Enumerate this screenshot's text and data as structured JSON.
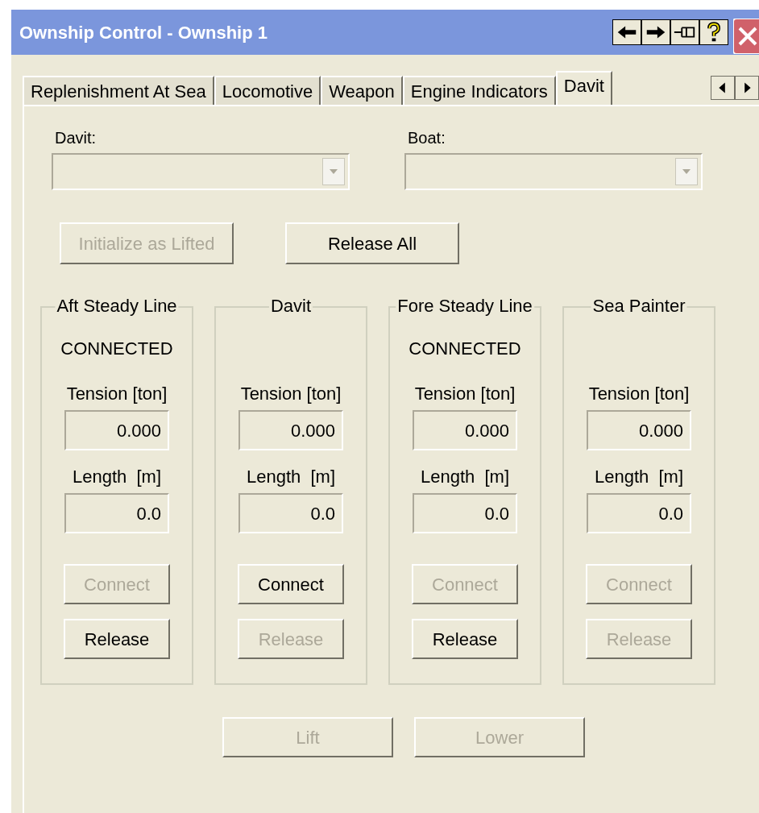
{
  "window": {
    "title": "Ownship Control - Ownship 1"
  },
  "tabs": [
    {
      "label": "Replenishment At Sea",
      "selected": false
    },
    {
      "label": "Locomotive",
      "selected": false
    },
    {
      "label": "Weapon",
      "selected": false
    },
    {
      "label": "Engine Indicators",
      "selected": false
    },
    {
      "label": "Davit",
      "selected": true
    }
  ],
  "selectors": [
    {
      "label": "Davit:",
      "disabled": true
    },
    {
      "label": "Boat:",
      "disabled": true
    }
  ],
  "top_buttons": [
    {
      "label": "Initialize as Lifted",
      "disabled": true
    },
    {
      "label": "Release All",
      "disabled": false
    }
  ],
  "groups": [
    {
      "title": "Aft Steady Line",
      "status": "CONNECTED",
      "tension_label": "Tension [ton]",
      "tension": "0.000",
      "length_label": "Length  [m]",
      "length": "0.0",
      "buttons": [
        {
          "label": "Connect",
          "disabled": true
        },
        {
          "label": "Release",
          "disabled": false
        }
      ]
    },
    {
      "title": "Davit",
      "tension_label": "Tension [ton]",
      "tension": "0.000",
      "length_label": "Length  [m]",
      "length": "0.0",
      "buttons": [
        {
          "label": "Connect",
          "disabled": false
        },
        {
          "label": "Release",
          "disabled": true
        }
      ]
    },
    {
      "title": "Fore Steady Line",
      "status": "CONNECTED",
      "tension_label": "Tension [ton]",
      "tension": "0.000",
      "length_label": "Length  [m]",
      "length": "0.0",
      "buttons": [
        {
          "label": "Connect",
          "disabled": true
        },
        {
          "label": "Release",
          "disabled": false
        }
      ]
    },
    {
      "title": "Sea Painter",
      "tension_label": "Tension [ton]",
      "tension": "0.000",
      "length_label": "Length  [m]",
      "length": "0.0",
      "buttons": [
        {
          "label": "Connect",
          "disabled": true
        },
        {
          "label": "Release",
          "disabled": true
        }
      ]
    }
  ],
  "bottom_buttons": [
    {
      "label": "Lift",
      "disabled": true
    },
    {
      "label": "Lower",
      "disabled": true
    }
  ]
}
